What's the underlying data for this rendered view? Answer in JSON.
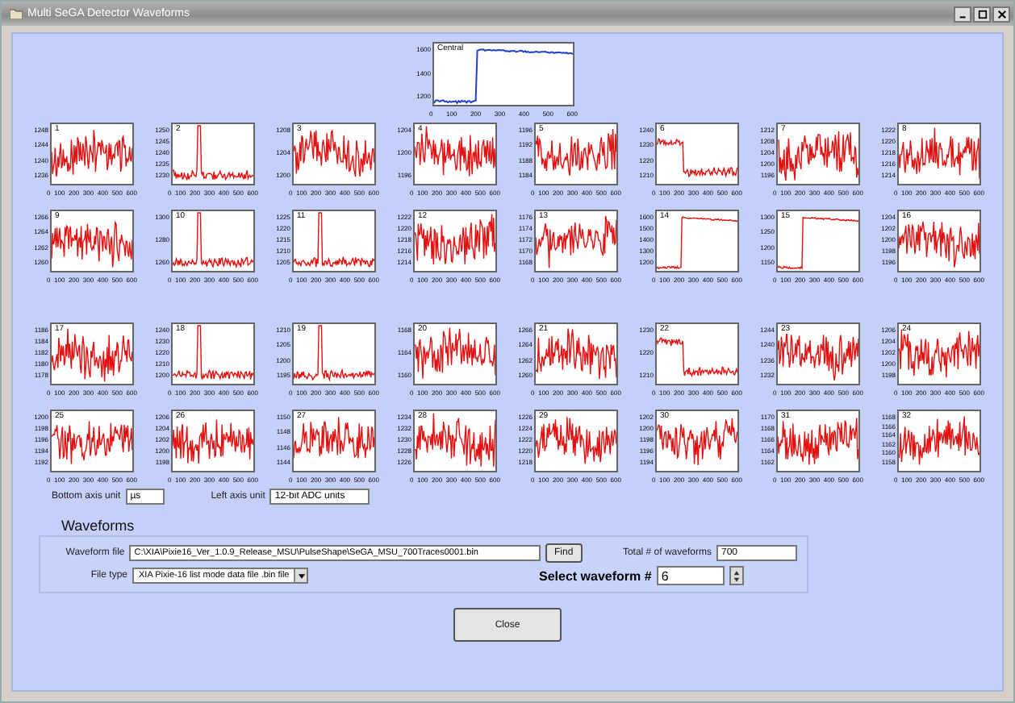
{
  "window": {
    "title": "Multi SeGA Detector Waveforms"
  },
  "central_plot": {
    "label": "Central",
    "kind": "step_up",
    "y_tick_labels": [
      "1600",
      "1400",
      "1200"
    ],
    "x_tick_labels": [
      "0",
      "100",
      "200",
      "300",
      "400",
      "500",
      "600"
    ]
  },
  "plot_rows": [
    {
      "plots": [
        {
          "label": "1",
          "kind": "noise",
          "y_tick_labels": [
            "1248",
            "1244",
            "1240",
            "1236"
          ],
          "x_tick_labels": [
            "0",
            "100",
            "200",
            "300",
            "400",
            "500",
            "600"
          ]
        },
        {
          "label": "2",
          "kind": "spike",
          "y_tick_labels": [
            "1250",
            "1245",
            "1240",
            "1235",
            "1230"
          ],
          "x_tick_labels": [
            "0",
            "100",
            "200",
            "300",
            "400",
            "500",
            "600"
          ]
        },
        {
          "label": "3",
          "kind": "noise",
          "y_tick_labels": [
            "1208",
            "1204",
            "1200"
          ],
          "x_tick_labels": [
            "0",
            "100",
            "200",
            "300",
            "400",
            "500",
            "600"
          ]
        },
        {
          "label": "4",
          "kind": "noise",
          "y_tick_labels": [
            "1204",
            "1200",
            "1196"
          ],
          "x_tick_labels": [
            "0",
            "100",
            "200",
            "300",
            "400",
            "500",
            "600"
          ]
        },
        {
          "label": "5",
          "kind": "noise",
          "y_tick_labels": [
            "1196",
            "1192",
            "1188",
            "1184"
          ],
          "x_tick_labels": [
            "0",
            "100",
            "200",
            "300",
            "400",
            "500",
            "600"
          ]
        },
        {
          "label": "6",
          "kind": "step_down",
          "y_tick_labels": [
            "1240",
            "1230",
            "1220",
            "1210"
          ],
          "x_tick_labels": [
            "0",
            "100",
            "200",
            "300",
            "400",
            "500",
            "600"
          ]
        },
        {
          "label": "7",
          "kind": "noise",
          "y_tick_labels": [
            "1212",
            "1208",
            "1204",
            "1200",
            "1196"
          ],
          "x_tick_labels": [
            "0",
            "100",
            "200",
            "300",
            "400",
            "500",
            "600"
          ]
        },
        {
          "label": "8",
          "kind": "noise",
          "y_tick_labels": [
            "1222",
            "1220",
            "1218",
            "1216",
            "1214"
          ],
          "x_tick_labels": [
            "0",
            "100",
            "200",
            "300",
            "400",
            "500",
            "600"
          ]
        }
      ]
    },
    {
      "plots": [
        {
          "label": "9",
          "kind": "noise",
          "y_tick_labels": [
            "1266",
            "1264",
            "1262",
            "1260"
          ],
          "x_tick_labels": [
            "0",
            "100",
            "200",
            "300",
            "400",
            "500",
            "600"
          ]
        },
        {
          "label": "10",
          "kind": "spike",
          "y_tick_labels": [
            "1300",
            "1280",
            "1260"
          ],
          "x_tick_labels": [
            "0",
            "100",
            "200",
            "300",
            "400",
            "500",
            "600"
          ]
        },
        {
          "label": "11",
          "kind": "spike",
          "y_tick_labels": [
            "1225",
            "1220",
            "1215",
            "1210",
            "1205"
          ],
          "x_tick_labels": [
            "0",
            "100",
            "200",
            "300",
            "400",
            "500",
            "600"
          ]
        },
        {
          "label": "12",
          "kind": "noise",
          "y_tick_labels": [
            "1222",
            "1220",
            "1218",
            "1216",
            "1214"
          ],
          "x_tick_labels": [
            "0",
            "100",
            "200",
            "300",
            "400",
            "500",
            "600"
          ]
        },
        {
          "label": "13",
          "kind": "noise",
          "y_tick_labels": [
            "1176",
            "1174",
            "1172",
            "1170",
            "1168"
          ],
          "x_tick_labels": [
            "0",
            "100",
            "200",
            "300",
            "400",
            "500",
            "600"
          ]
        },
        {
          "label": "14",
          "kind": "step_up",
          "y_tick_labels": [
            "1600",
            "1500",
            "1400",
            "1300",
            "1200"
          ],
          "x_tick_labels": [
            "0",
            "100",
            "200",
            "300",
            "400",
            "500",
            "600"
          ]
        },
        {
          "label": "15",
          "kind": "step_up",
          "y_tick_labels": [
            "1300",
            "1250",
            "1200",
            "1150"
          ],
          "x_tick_labels": [
            "0",
            "100",
            "200",
            "300",
            "400",
            "500",
            "600"
          ]
        },
        {
          "label": "16",
          "kind": "noise",
          "y_tick_labels": [
            "1204",
            "1202",
            "1200",
            "1198",
            "1196"
          ],
          "x_tick_labels": [
            "0",
            "100",
            "200",
            "300",
            "400",
            "500",
            "600"
          ]
        }
      ]
    },
    {
      "plots": [
        {
          "label": "17",
          "kind": "noise",
          "y_tick_labels": [
            "1186",
            "1184",
            "1182",
            "1180",
            "1178"
          ],
          "x_tick_labels": [
            "0",
            "100",
            "200",
            "300",
            "400",
            "500",
            "600"
          ]
        },
        {
          "label": "18",
          "kind": "spike",
          "y_tick_labels": [
            "1240",
            "1230",
            "1220",
            "1210",
            "1200"
          ],
          "x_tick_labels": [
            "0",
            "100",
            "200",
            "300",
            "400",
            "500",
            "600"
          ]
        },
        {
          "label": "19",
          "kind": "spike",
          "y_tick_labels": [
            "1210",
            "1205",
            "1200",
            "1195"
          ],
          "x_tick_labels": [
            "0",
            "100",
            "200",
            "300",
            "400",
            "500",
            "600"
          ]
        },
        {
          "label": "20",
          "kind": "noise",
          "y_tick_labels": [
            "1168",
            "1164",
            "1160"
          ],
          "x_tick_labels": [
            "0",
            "100",
            "200",
            "300",
            "400",
            "500",
            "600"
          ]
        },
        {
          "label": "21",
          "kind": "noise",
          "y_tick_labels": [
            "1266",
            "1264",
            "1262",
            "1260"
          ],
          "x_tick_labels": [
            "0",
            "100",
            "200",
            "300",
            "400",
            "500",
            "600"
          ]
        },
        {
          "label": "22",
          "kind": "step_down",
          "y_tick_labels": [
            "1230",
            "1220",
            "1210"
          ],
          "x_tick_labels": [
            "0",
            "100",
            "200",
            "300",
            "400",
            "500",
            "600"
          ]
        },
        {
          "label": "23",
          "kind": "noise",
          "y_tick_labels": [
            "1244",
            "1240",
            "1236",
            "1232"
          ],
          "x_tick_labels": [
            "0",
            "100",
            "200",
            "300",
            "400",
            "500",
            "600"
          ]
        },
        {
          "label": "24",
          "kind": "noise",
          "y_tick_labels": [
            "1206",
            "1204",
            "1202",
            "1200",
            "1198"
          ],
          "x_tick_labels": [
            "0",
            "100",
            "200",
            "300",
            "400",
            "500",
            "600"
          ]
        }
      ]
    },
    {
      "plots": [
        {
          "label": "25",
          "kind": "noise",
          "y_tick_labels": [
            "1200",
            "1198",
            "1196",
            "1194",
            "1192"
          ],
          "x_tick_labels": [
            "0",
            "100",
            "200",
            "300",
            "400",
            "500",
            "600"
          ]
        },
        {
          "label": "26",
          "kind": "noise",
          "y_tick_labels": [
            "1206",
            "1204",
            "1202",
            "1200",
            "1198"
          ],
          "x_tick_labels": [
            "0",
            "100",
            "200",
            "300",
            "400",
            "500",
            "600"
          ]
        },
        {
          "label": "27",
          "kind": "noise",
          "y_tick_labels": [
            "1150",
            "1148",
            "1146",
            "1144"
          ],
          "x_tick_labels": [
            "0",
            "100",
            "200",
            "300",
            "400",
            "500",
            "600"
          ]
        },
        {
          "label": "28",
          "kind": "noise",
          "y_tick_labels": [
            "1234",
            "1232",
            "1230",
            "1228",
            "1226"
          ],
          "x_tick_labels": [
            "0",
            "100",
            "200",
            "300",
            "400",
            "500",
            "600"
          ]
        },
        {
          "label": "29",
          "kind": "noise",
          "y_tick_labels": [
            "1226",
            "1224",
            "1222",
            "1220",
            "1218"
          ],
          "x_tick_labels": [
            "0",
            "100",
            "200",
            "300",
            "400",
            "500",
            "600"
          ]
        },
        {
          "label": "30",
          "kind": "noise",
          "y_tick_labels": [
            "1202",
            "1200",
            "1198",
            "1196",
            "1194"
          ],
          "x_tick_labels": [
            "0",
            "100",
            "200",
            "300",
            "400",
            "500",
            "600"
          ]
        },
        {
          "label": "31",
          "kind": "noise",
          "y_tick_labels": [
            "1170",
            "1168",
            "1166",
            "1164",
            "1162"
          ],
          "x_tick_labels": [
            "0",
            "100",
            "200",
            "300",
            "400",
            "500",
            "600"
          ]
        },
        {
          "label": "32",
          "kind": "noise",
          "y_tick_labels": [
            "1168",
            "1166",
            "1164",
            "1162",
            "1160",
            "1158"
          ],
          "x_tick_labels": [
            "0",
            "100",
            "200",
            "300",
            "400",
            "500",
            "600"
          ]
        }
      ]
    }
  ],
  "axis_units": {
    "bottom_label": "Bottom axis unit",
    "bottom_value": "µs",
    "left_label": "Left axis unit",
    "left_value": "12-bit ADC units"
  },
  "waveforms": {
    "title": "Waveforms",
    "file_label": "Waveform file",
    "file_value": "C:\\XIA\\Pixie16_Ver_1.0.9_Release_MSU\\PulseShape\\SeGA_MSU_700Traces0001.bin",
    "find_button": "Find",
    "total_label": "Total # of waveforms",
    "total_value": "700",
    "type_label": "File type",
    "type_value": "XIA Pixie-16 list mode data file .bin file",
    "select_label": "Select waveform #",
    "select_value": "6"
  },
  "close_button": "Close"
}
